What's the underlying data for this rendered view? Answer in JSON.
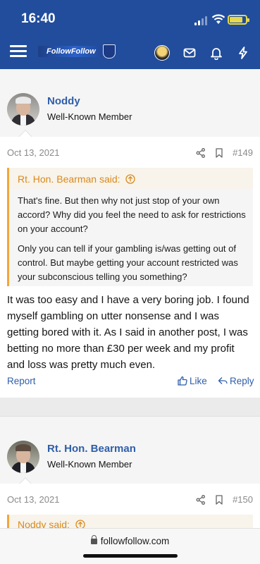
{
  "status_bar": {
    "time": "16:40"
  },
  "header": {
    "logo_text": "FollowFollow"
  },
  "posts": [
    {
      "author": "Noddy",
      "member_title": "Well-Known Member",
      "date": "Oct 13, 2021",
      "post_number": "#149",
      "quote": {
        "title": "Rt. Hon. Bearman said:",
        "paragraph1": "That's fine. But then why not just stop of your own accord? Why did you feel the need to ask for restrictions on your account?",
        "paragraph2": "Only you can tell if your gambling is/was getting out of control. But maybe getting your account restricted was your subconscious telling you something?"
      },
      "message": "It was too easy and I have a very boring job. I found myself gambling on utter nonsense and I was getting bored with it. As I said in another post, I was betting no more than £30 per week and my profit and loss was pretty much even.",
      "actions": {
        "report": "Report",
        "like": "Like",
        "reply": "Reply"
      }
    },
    {
      "author": "Rt. Hon. Bearman",
      "member_title": "Well-Known Member",
      "date": "Oct 13, 2021",
      "post_number": "#150",
      "quote": {
        "title": "Noddy said:"
      }
    }
  ],
  "browser": {
    "url": "followfollow.com"
  },
  "colors": {
    "header_bg": "#214d9c",
    "link": "#2f5ea8",
    "quote_accent": "#f1a63a"
  }
}
